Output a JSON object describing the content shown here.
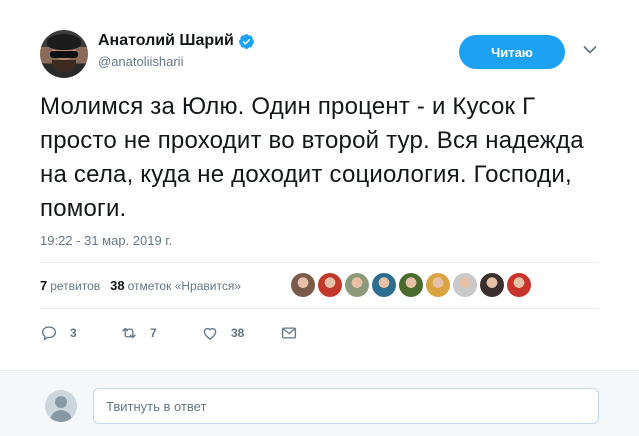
{
  "author": {
    "name": "Анатолий Шарий",
    "handle": "@anatoliisharii",
    "verified": true
  },
  "follow_button": {
    "label": "Читаю"
  },
  "tweet": {
    "text": "Молимся за Юлю. Один процент - и Кусок Г просто не проходит во второй тур. Вся надежда на села, куда не доходит социология. Господи, помоги.",
    "timestamp": "19:22 - 31 мар. 2019 г."
  },
  "stats": {
    "retweets_count": "7",
    "retweets_label": "ретвитов",
    "likes_count": "38",
    "likes_label": "отметок «Нравится»"
  },
  "likers": [
    {
      "name": "liker-1",
      "color": "#7a5a4a"
    },
    {
      "name": "liker-2",
      "color": "#c0392b"
    },
    {
      "name": "liker-3",
      "color": "#8d9a7a"
    },
    {
      "name": "liker-4",
      "color": "#2c6e8f"
    },
    {
      "name": "liker-5",
      "color": "#4a6b2e"
    },
    {
      "name": "liker-6",
      "color": "#d9a441"
    },
    {
      "name": "liker-7",
      "color": "#c9c9c9"
    },
    {
      "name": "liker-8",
      "color": "#3a2e2e"
    },
    {
      "name": "liker-9",
      "color": "#c8342b"
    }
  ],
  "actions": {
    "reply_count": "3",
    "retweet_count": "7",
    "like_count": "38"
  },
  "reply_box": {
    "placeholder": "Твитнуть в ответ"
  },
  "colors": {
    "accent": "#1da1f2",
    "text": "#14171a",
    "secondary": "#657786",
    "divider": "#e6ecf0"
  }
}
